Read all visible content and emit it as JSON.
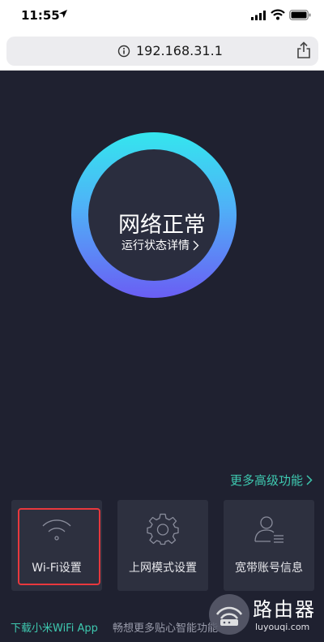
{
  "status_bar": {
    "time": "11:55",
    "icons": [
      "location-arrow-icon",
      "cellular-signal-icon",
      "wifi-icon",
      "battery-icon"
    ]
  },
  "browser": {
    "url": "192.168.31.1",
    "icons": [
      "info-icon",
      "share-icon"
    ]
  },
  "network_status": {
    "title": "网络正常",
    "details_label": "运行状态详情",
    "ring_colors": [
      "#34e6ee",
      "#4fb1f7",
      "#6a5ef4"
    ]
  },
  "more_features": {
    "label": "更多高级功能"
  },
  "cards": [
    {
      "label": "Wi-Fi设置",
      "icon": "wifi-icon"
    },
    {
      "label": "上网模式设置",
      "icon": "gear-icon"
    },
    {
      "label": "宽带账号信息",
      "icon": "user-account-icon"
    }
  ],
  "bottom": {
    "download_link": "下载小米WiFi App",
    "download_desc": "畅想更多贴心智能功能"
  },
  "watermark": {
    "title": "路由器",
    "url": "luyouqi.com"
  },
  "colors": {
    "accent": "#3ec9b0",
    "background": "#1f2130",
    "card": "#2d303f",
    "highlight": "#e8383d"
  }
}
